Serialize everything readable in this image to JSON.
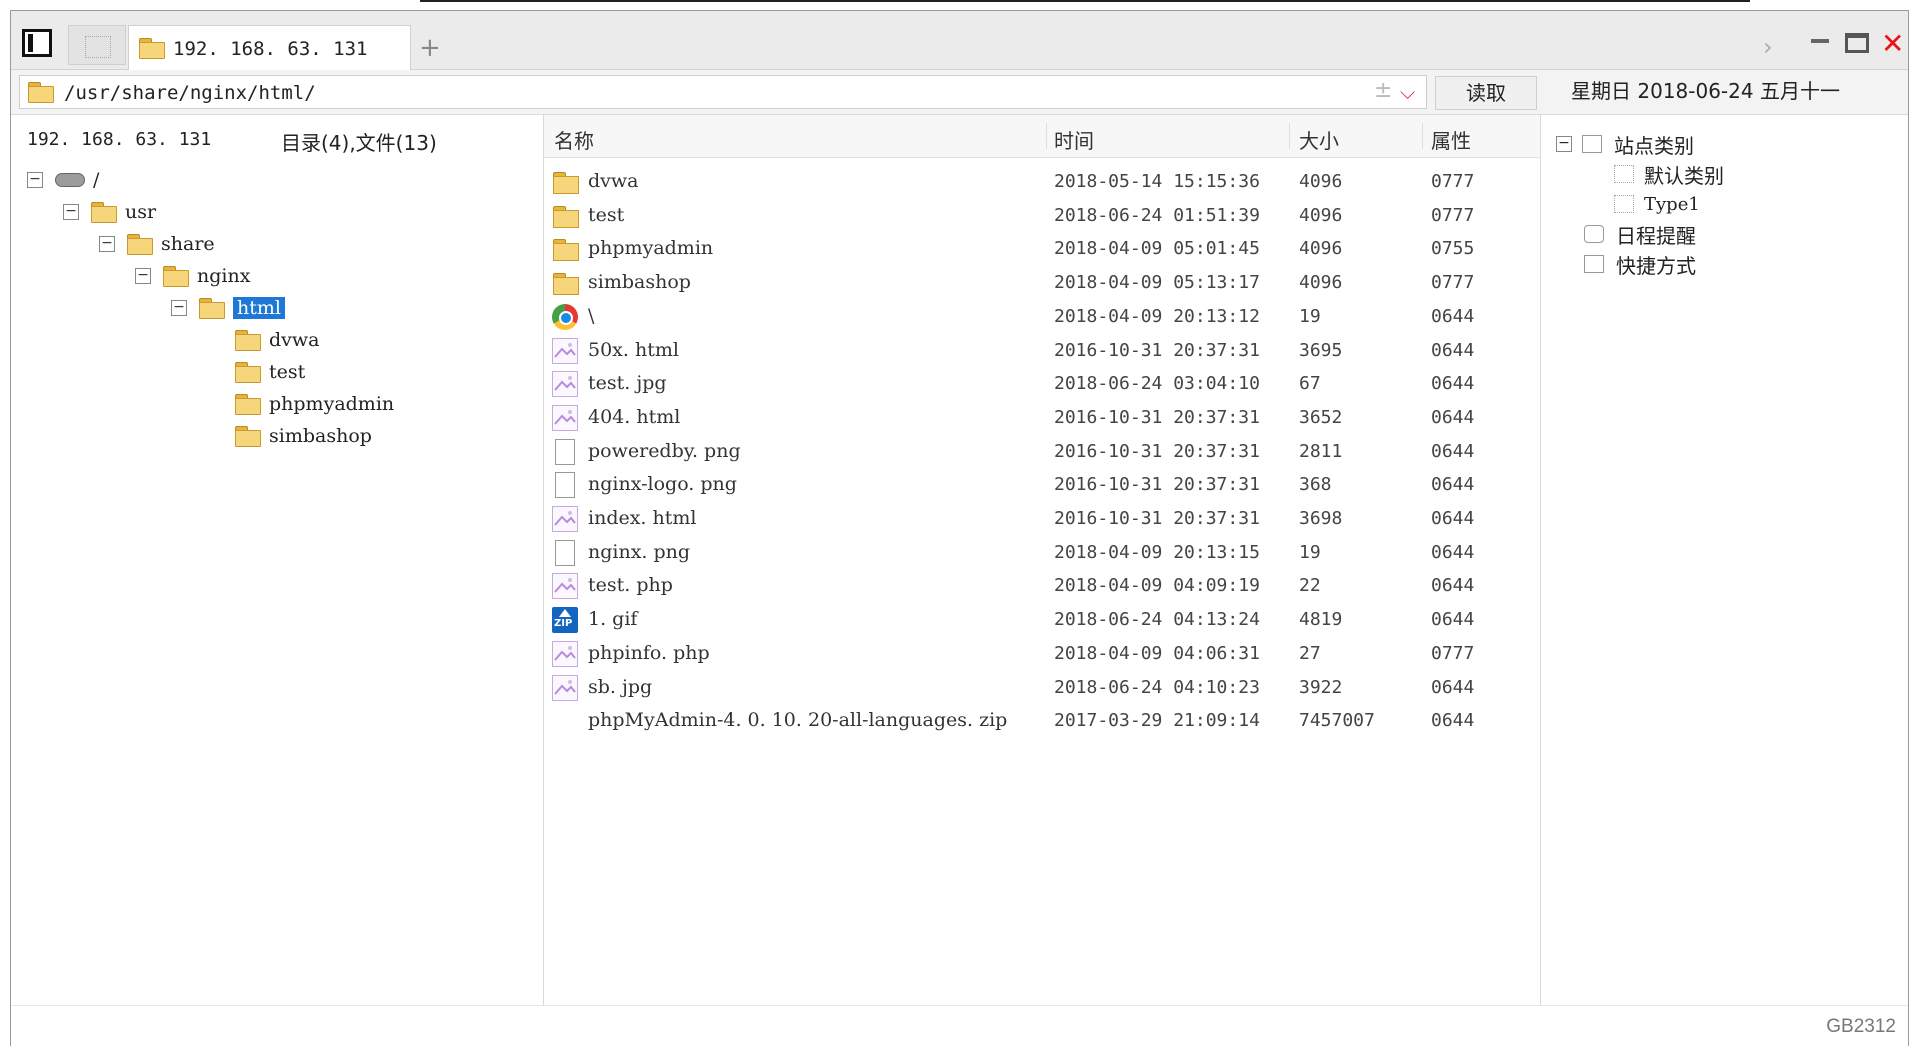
{
  "tabs": [
    {
      "title": "192. 168. 63. 131"
    }
  ],
  "address": {
    "path": "/usr/share/nginx/html/",
    "read_label": "读取",
    "date": "星期日 2018-06-24 五月十一"
  },
  "tree": {
    "host": "192. 168. 63. 131",
    "count": "目录(4),文件(13)",
    "nodes": [
      "/",
      "usr",
      "share",
      "nginx",
      "html",
      "dvwa",
      "test",
      "phpmyadmin",
      "simbashop"
    ]
  },
  "files": {
    "headers": {
      "name": "名称",
      "time": "时间",
      "size": "大小",
      "attr": "属性"
    },
    "rows": [
      {
        "name": "dvwa",
        "time": "2018-05-14 15:15:36",
        "size": "4096",
        "attr": "0777",
        "icon": "folder-icon"
      },
      {
        "name": "test",
        "time": "2018-06-24 01:51:39",
        "size": "4096",
        "attr": "0777",
        "icon": "folder-icon"
      },
      {
        "name": "phpmyadmin",
        "time": "2018-04-09 05:01:45",
        "size": "4096",
        "attr": "0755",
        "icon": "folder-icon"
      },
      {
        "name": "simbashop",
        "time": "2018-04-09 05:13:17",
        "size": "4096",
        "attr": "0777",
        "icon": "folder-icon"
      },
      {
        "name": "\\",
        "time": "2018-04-09 20:13:12",
        "size": "19",
        "attr": "0644",
        "icon": "chrome-icon"
      },
      {
        "name": "50x. html",
        "time": "2016-10-31 20:37:31",
        "size": "3695",
        "attr": "0644",
        "icon": "image-icon"
      },
      {
        "name": "test. jpg",
        "time": "2018-06-24 03:04:10",
        "size": "67",
        "attr": "0644",
        "icon": "image-icon"
      },
      {
        "name": "404. html",
        "time": "2016-10-31 20:37:31",
        "size": "3652",
        "attr": "0644",
        "icon": "image-icon"
      },
      {
        "name": "poweredby. png",
        "time": "2016-10-31 20:37:31",
        "size": "2811",
        "attr": "0644",
        "icon": "document-icon"
      },
      {
        "name": "nginx-logo. png",
        "time": "2016-10-31 20:37:31",
        "size": "368",
        "attr": "0644",
        "icon": "document-icon"
      },
      {
        "name": "index. html",
        "time": "2016-10-31 20:37:31",
        "size": "3698",
        "attr": "0644",
        "icon": "image-icon"
      },
      {
        "name": "nginx. png",
        "time": "2018-04-09 20:13:15",
        "size": "19",
        "attr": "0644",
        "icon": "document-icon"
      },
      {
        "name": "test. php",
        "time": "2018-04-09 04:09:19",
        "size": "22",
        "attr": "0644",
        "icon": "image-icon"
      },
      {
        "name": "1. gif",
        "time": "2018-06-24 04:13:24",
        "size": "4819",
        "attr": "0644",
        "icon": "zip-icon"
      },
      {
        "name": "phpinfo. php",
        "time": "2018-04-09 04:06:31",
        "size": "27",
        "attr": "0777",
        "icon": "image-icon"
      },
      {
        "name": "sb. jpg",
        "time": "2018-06-24 04:10:23",
        "size": "3922",
        "attr": "0644",
        "icon": "image-icon"
      },
      {
        "name": "phpMyAdmin-4. 0. 10. 20-all-languages. zip",
        "time": "2017-03-29 21:09:14",
        "size": "7457007",
        "attr": "0644",
        "icon": "none"
      }
    ]
  },
  "sites": {
    "root": "站点类别",
    "children": [
      "默认类别",
      "Type1"
    ],
    "schedule": "日程提醒",
    "shortcuts": "快捷方式"
  },
  "status": {
    "encoding": "GB2312"
  },
  "colors": {
    "selection": "#1e78d7",
    "close": "#e11111"
  }
}
